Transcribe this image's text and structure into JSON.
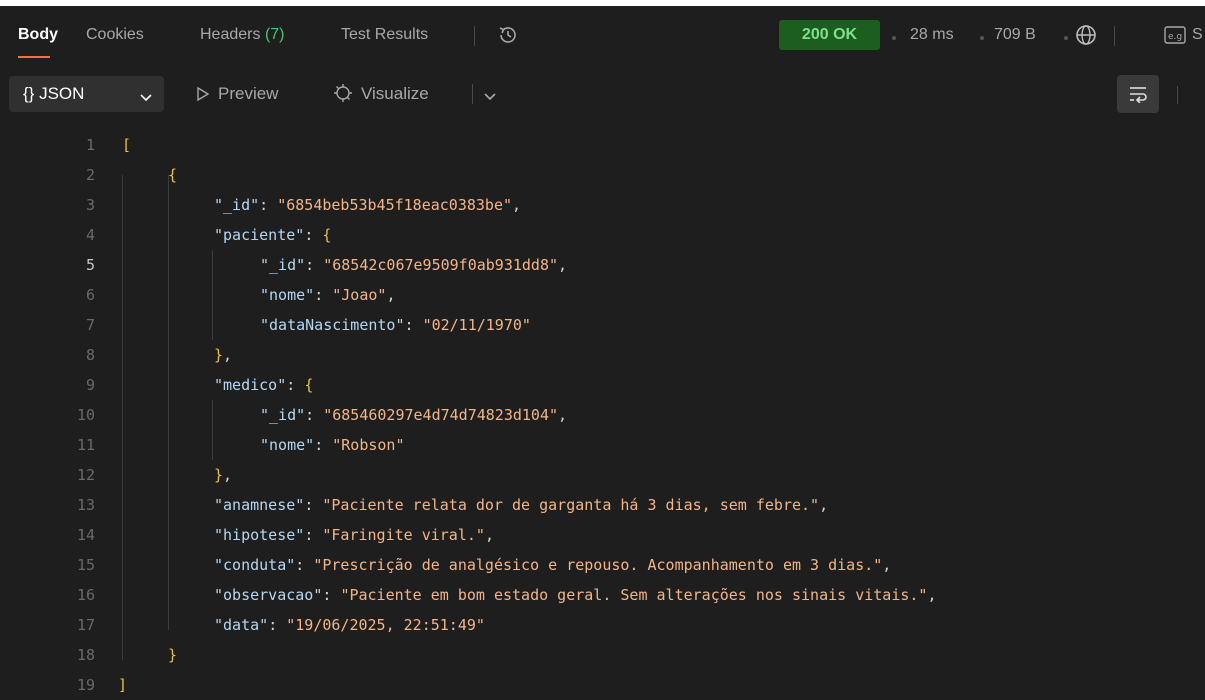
{
  "tabs": [
    {
      "label": "Body"
    },
    {
      "label": "Cookies"
    },
    {
      "label": "Headers",
      "count": "(7)"
    },
    {
      "label": "Test Results"
    }
  ],
  "response_meta": {
    "status": "200 OK",
    "time": "28 ms",
    "size": "709 B",
    "cutoff_label": "S"
  },
  "toolbar": {
    "format": "{} JSON",
    "preview": "Preview",
    "visualize": "Visualize"
  },
  "editor": {
    "current_line": 5,
    "lines": [
      {
        "n": "1",
        "tokens": [
          [
            "b",
            "["
          ]
        ]
      },
      {
        "n": "2",
        "tokens": [
          [
            "b",
            "{"
          ]
        ]
      },
      {
        "n": "3",
        "tokens": [
          [
            "k",
            "\"_id\""
          ],
          [
            "p",
            ": "
          ],
          [
            "s",
            "\"6854beb53b45f18eac0383be\""
          ],
          [
            "p",
            ","
          ]
        ]
      },
      {
        "n": "4",
        "tokens": [
          [
            "k",
            "\"paciente\""
          ],
          [
            "p",
            ": "
          ],
          [
            "b",
            "{"
          ]
        ]
      },
      {
        "n": "5",
        "tokens": [
          [
            "k",
            "\"_id\""
          ],
          [
            "p",
            ": "
          ],
          [
            "s",
            "\"68542c067e9509f0ab931dd8\""
          ],
          [
            "p",
            ","
          ]
        ]
      },
      {
        "n": "6",
        "tokens": [
          [
            "k",
            "\"nome\""
          ],
          [
            "p",
            ": "
          ],
          [
            "s",
            "\"Joao\""
          ],
          [
            "p",
            ","
          ]
        ]
      },
      {
        "n": "7",
        "tokens": [
          [
            "k",
            "\"dataNascimento\""
          ],
          [
            "p",
            ": "
          ],
          [
            "s",
            "\"02/11/1970\""
          ]
        ]
      },
      {
        "n": "8",
        "tokens": [
          [
            "b",
            "}"
          ],
          [
            "p",
            ","
          ]
        ]
      },
      {
        "n": "9",
        "tokens": [
          [
            "k",
            "\"medico\""
          ],
          [
            "p",
            ": "
          ],
          [
            "b",
            "{"
          ]
        ]
      },
      {
        "n": "10",
        "tokens": [
          [
            "k",
            "\"_id\""
          ],
          [
            "p",
            ": "
          ],
          [
            "s",
            "\"685460297e4d74d74823d104\""
          ],
          [
            "p",
            ","
          ]
        ]
      },
      {
        "n": "11",
        "tokens": [
          [
            "k",
            "\"nome\""
          ],
          [
            "p",
            ": "
          ],
          [
            "s",
            "\"Robson\""
          ]
        ]
      },
      {
        "n": "12",
        "tokens": [
          [
            "b",
            "}"
          ],
          [
            "p",
            ","
          ]
        ]
      },
      {
        "n": "13",
        "tokens": [
          [
            "k",
            "\"anamnese\""
          ],
          [
            "p",
            ": "
          ],
          [
            "s",
            "\"Paciente relata dor de garganta há 3 dias, sem febre.\""
          ],
          [
            "p",
            ","
          ]
        ]
      },
      {
        "n": "14",
        "tokens": [
          [
            "k",
            "\"hipotese\""
          ],
          [
            "p",
            ": "
          ],
          [
            "s",
            "\"Faringite viral.\""
          ],
          [
            "p",
            ","
          ]
        ]
      },
      {
        "n": "15",
        "tokens": [
          [
            "k",
            "\"conduta\""
          ],
          [
            "p",
            ": "
          ],
          [
            "s",
            "\"Prescrição de analgésico e repouso. Acompanhamento em 3 dias.\""
          ],
          [
            "p",
            ","
          ]
        ]
      },
      {
        "n": "16",
        "tokens": [
          [
            "k",
            "\"observacao\""
          ],
          [
            "p",
            ": "
          ],
          [
            "s",
            "\"Paciente em bom estado geral. Sem alterações nos sinais vitais.\""
          ],
          [
            "p",
            ","
          ]
        ]
      },
      {
        "n": "17",
        "tokens": [
          [
            "k",
            "\"data\""
          ],
          [
            "p",
            ": "
          ],
          [
            "s",
            "\"19/06/2025, 22:51:49\""
          ]
        ]
      },
      {
        "n": "18",
        "tokens": [
          [
            "b",
            "}"
          ]
        ]
      },
      {
        "n": "19",
        "tokens": [
          [
            "b",
            "]"
          ]
        ]
      }
    ]
  }
}
